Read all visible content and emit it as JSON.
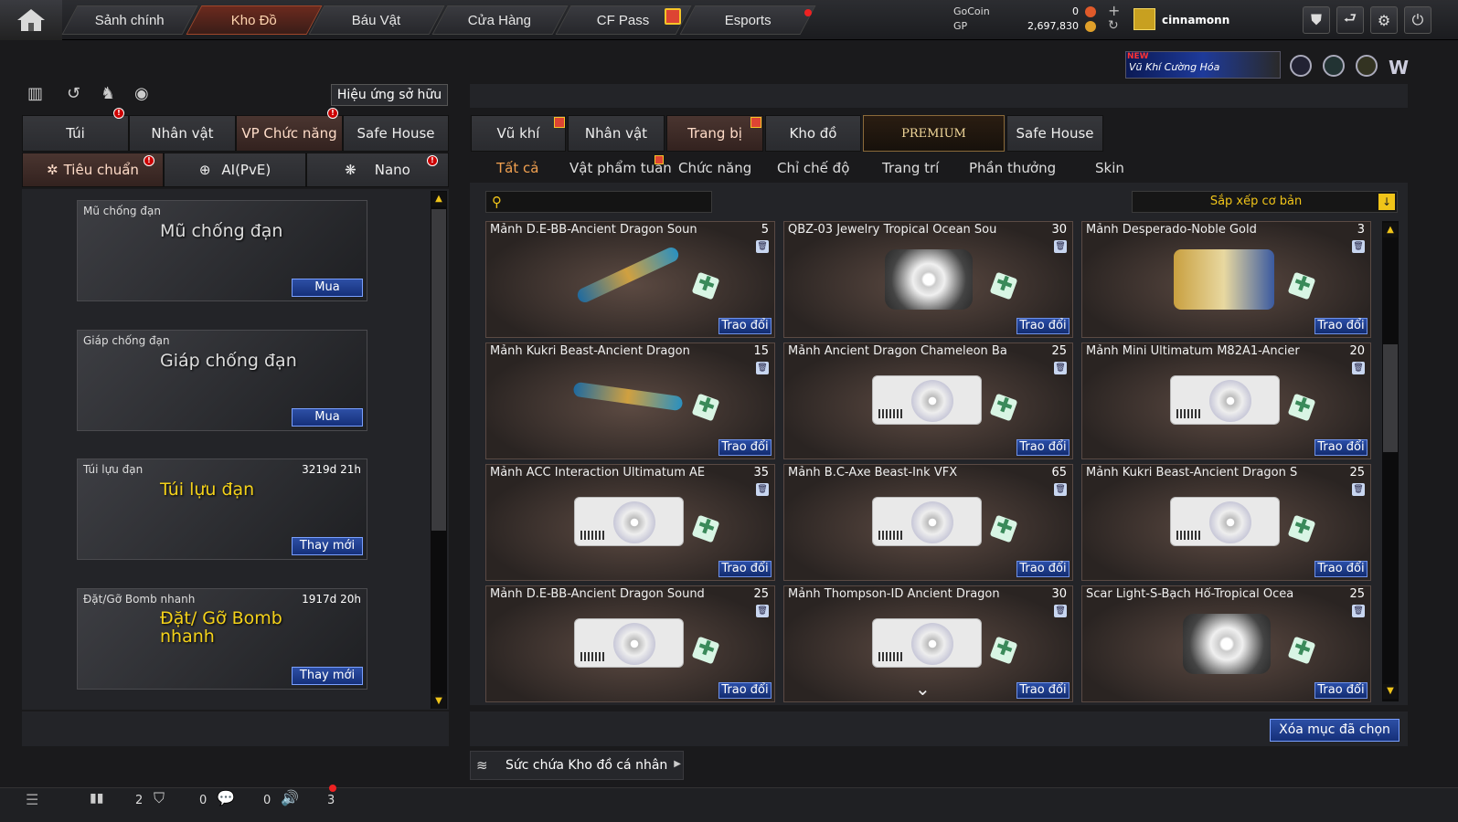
{
  "nav": {
    "items": [
      {
        "label": "Sảnh chính"
      },
      {
        "label": "Kho Đồ"
      },
      {
        "label": "Báu Vật"
      },
      {
        "label": "Cửa Hàng"
      },
      {
        "label": "CF Pass"
      },
      {
        "label": "Esports"
      }
    ]
  },
  "currency": {
    "gocoin_label": "GoCoin",
    "gocoin_value": "0",
    "gp_label": "GP",
    "gp_value": "2,697,830"
  },
  "user": {
    "name": "cinnamonn"
  },
  "promo": {
    "new_tag": "NEW",
    "text": "Vũ Khí Cường Hóa"
  },
  "left": {
    "owned_effects": "Hiệu ứng sở hữu",
    "tabs": [
      {
        "label": "Túi"
      },
      {
        "label": "Nhân vật"
      },
      {
        "label": "VP Chức năng"
      },
      {
        "label": "Safe House"
      }
    ],
    "modes": [
      {
        "label": "Tiêu chuẩn"
      },
      {
        "label": "AI(PvE)"
      },
      {
        "label": "Nano"
      }
    ],
    "items": [
      {
        "title": "Mũ chống đạn",
        "art": "Mũ chống đạn",
        "duration": "",
        "button": "Mua"
      },
      {
        "title": "Giáp chống đạn",
        "art": "Giáp chống đạn",
        "duration": "",
        "button": "Mua"
      },
      {
        "title": "Túi lựu đạn",
        "art": "Túi lựu đạn",
        "duration": "3219d 21h",
        "button": "Thay mới"
      },
      {
        "title": "Đặt/Gỡ Bomb nhanh",
        "art": "Đặt/ Gỡ Bomb nhanh",
        "duration": "1917d 20h",
        "button": "Thay mới"
      }
    ]
  },
  "right": {
    "tabs": [
      {
        "label": "Vũ khí"
      },
      {
        "label": "Nhân vật"
      },
      {
        "label": "Trang bị"
      },
      {
        "label": "Kho đồ"
      },
      {
        "label": "PREMIUM"
      },
      {
        "label": "Safe House"
      }
    ],
    "subtabs": [
      {
        "label": "Tất cả"
      },
      {
        "label": "Vật phẩm tuần"
      },
      {
        "label": "Chức năng"
      },
      {
        "label": "Chỉ chế độ"
      },
      {
        "label": "Trang trí"
      },
      {
        "label": "Phần thưởng"
      },
      {
        "label": "Skin"
      }
    ],
    "sort": "Sắp xếp cơ bản",
    "trade_label": "Trao đổi",
    "cards": [
      {
        "name": "Mảnh D.E-BB-Ancient Dragon Soun",
        "count": "5"
      },
      {
        "name": "QBZ-03 Jewelry Tropical Ocean Sou",
        "count": "30"
      },
      {
        "name": "Mảnh Desperado-Noble Gold",
        "count": "3"
      },
      {
        "name": "Mảnh Kukri Beast-Ancient Dragon",
        "count": "15"
      },
      {
        "name": "Mảnh Ancient Dragon Chameleon Ba",
        "count": "25"
      },
      {
        "name": "Mảnh Mini Ultimatum M82A1-Ancier",
        "count": "20"
      },
      {
        "name": "Mảnh ACC Interaction Ultimatum AE",
        "count": "35"
      },
      {
        "name": "Mảnh B.C-Axe Beast-Ink VFX",
        "count": "65"
      },
      {
        "name": "Mảnh Kukri Beast-Ancient Dragon S",
        "count": "25"
      },
      {
        "name": "Mảnh D.E-BB-Ancient Dragon Sound",
        "count": "25"
      },
      {
        "name": "Mảnh Thompson-ID Ancient Dragon",
        "count": "30"
      },
      {
        "name": "Scar Light-S-Bạch Hổ-Tropical Ocea",
        "count": "25"
      }
    ],
    "delete_selected": "Xóa mục đã chọn",
    "capacity": "Sức chứa Kho đồ cá nhân"
  },
  "bottom": {
    "count1": "2",
    "count2": "0",
    "count3": "0",
    "count4": "3"
  }
}
